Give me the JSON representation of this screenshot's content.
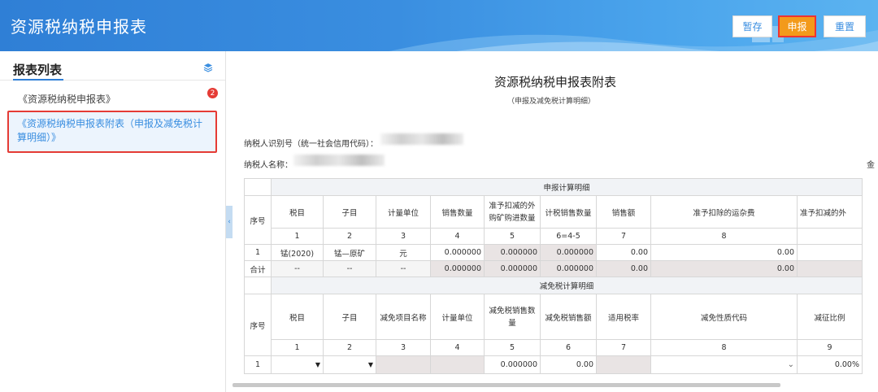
{
  "app": {
    "title": "资源税纳税申报表"
  },
  "toolbar": {
    "save_label": "暂存",
    "submit_label": "申报",
    "reset_label": "重置"
  },
  "sidebar": {
    "title": "报表列表",
    "items": [
      {
        "label": "《资源税纳税申报表》",
        "badge": "2"
      },
      {
        "label": "《资源税纳税申报表附表（申报及减免税计算明细）》"
      }
    ]
  },
  "form": {
    "title": "资源税纳税申报表附表",
    "subtitle": "（申报及减免税计算明细）",
    "taxpayer_id_label": "纳税人识别号（统一社会信用代码）：",
    "taxpayer_name_label": "纳税人名称：",
    "right_cut_label": "金"
  },
  "table1": {
    "section": "申报计算明细",
    "headers": [
      "序号",
      "税目",
      "子目",
      "计量单位",
      "销售数量",
      "准予扣减的外购矿购进数量",
      "计税销售数量",
      "销售额",
      "准予扣除的运杂费",
      "准予扣减的外"
    ],
    "numbers": [
      "1",
      "2",
      "3",
      "4",
      "5",
      "6=4-5",
      "7",
      "8"
    ],
    "row1": [
      "1",
      "锰(2020)",
      "锰—原矿",
      "元",
      "0.000000",
      "0.000000",
      "0.000000",
      "0.00",
      "0.00"
    ],
    "total": [
      "合计",
      "--",
      "--",
      "--",
      "0.000000",
      "0.000000",
      "0.000000",
      "0.00",
      "0.00"
    ]
  },
  "table2": {
    "section": "减免税计算明细",
    "headers": [
      "序号",
      "税目",
      "子目",
      "减免项目名称",
      "计量单位",
      "减免税销售数量",
      "减免税销售额",
      "适用税率",
      "减免性质代码",
      "减征比例"
    ],
    "numbers": [
      "1",
      "2",
      "3",
      "4",
      "5",
      "6",
      "7",
      "8",
      "9"
    ],
    "row1": [
      "1",
      "0.000000",
      "0.00",
      "0.00%"
    ]
  }
}
